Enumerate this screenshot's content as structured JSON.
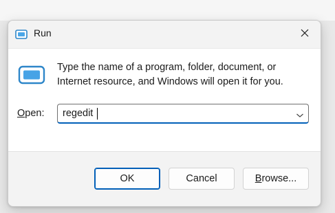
{
  "window": {
    "title": "Run",
    "close_icon": "close-icon",
    "app_icon": "run-app-icon"
  },
  "content": {
    "message_line1": "Type the name of a program, folder, document, or",
    "message_line2": "Internet resource, and Windows will open it for you.",
    "open_label_mnemonic": "O",
    "open_label_rest": "pen:",
    "open_value": "regedit",
    "dropdown_icon": "chevron-down-icon"
  },
  "buttons": {
    "ok": "OK",
    "cancel": "Cancel",
    "browse_mnemonic": "B",
    "browse_rest": "rowse..."
  },
  "colors": {
    "accent": "#005fb8",
    "icon_blue": "#2d86c9",
    "dialog_bg": "#f3f3f3",
    "content_bg": "#ffffff"
  }
}
